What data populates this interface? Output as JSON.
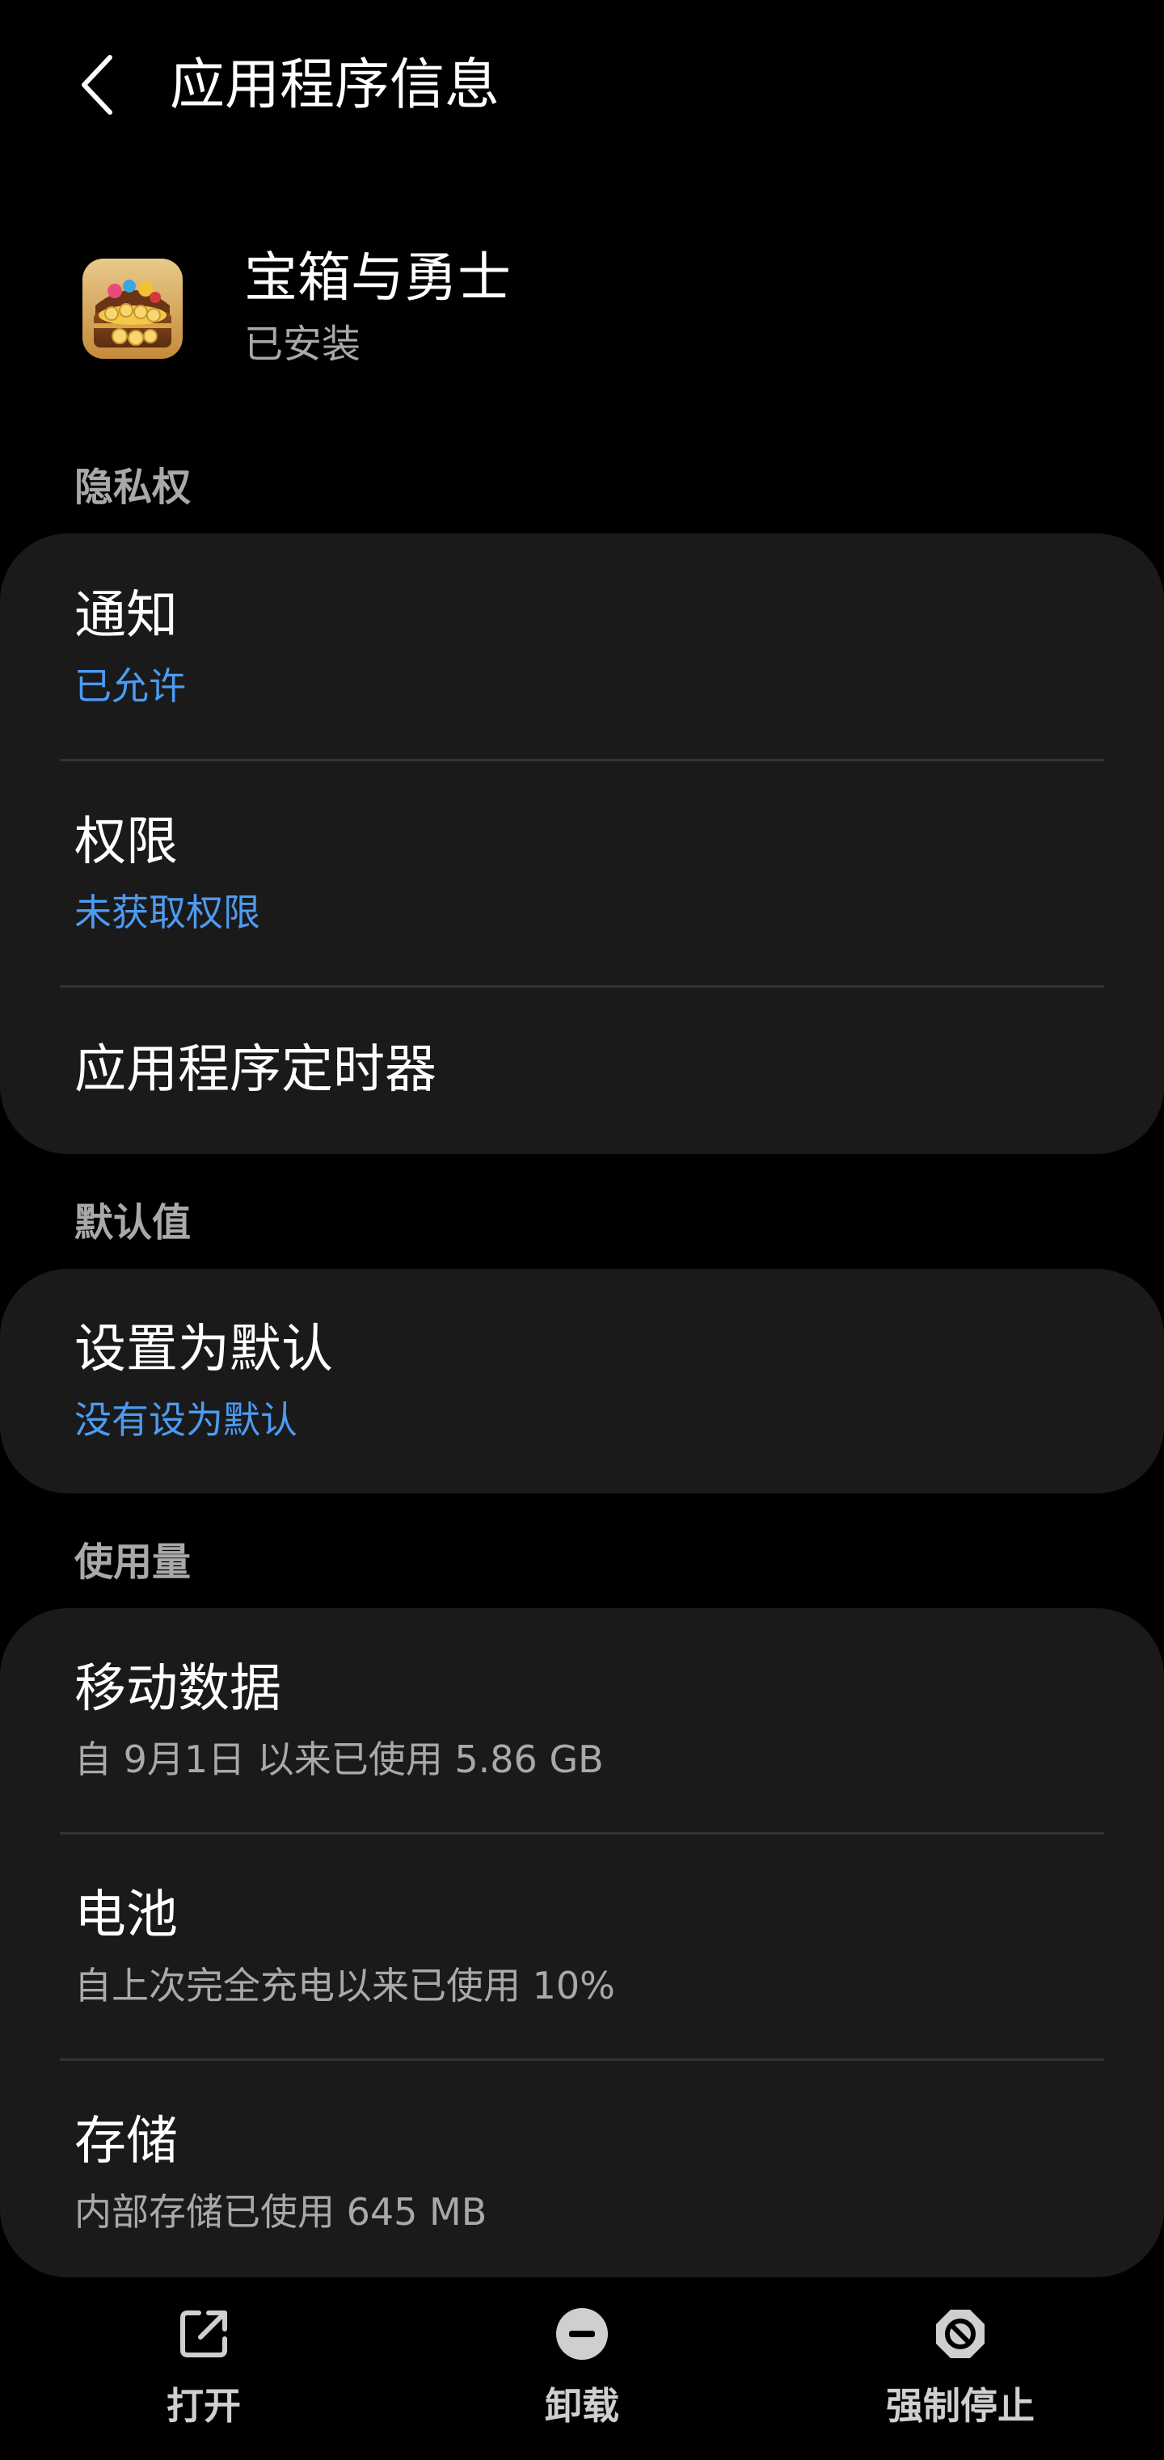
{
  "header": {
    "title": "应用程序信息",
    "back_icon": "chevron-left-icon"
  },
  "app": {
    "name": "宝箱与勇士",
    "status": "已安装",
    "icon": "treasure-chest-app-icon"
  },
  "sections": {
    "privacy": {
      "label": "隐私权",
      "items": [
        {
          "title": "通知",
          "subtitle": "已允许"
        },
        {
          "title": "权限",
          "subtitle": "未获取权限"
        },
        {
          "title": "应用程序定时器"
        }
      ]
    },
    "defaults": {
      "label": "默认值",
      "items": [
        {
          "title": "设置为默认",
          "subtitle": "没有设为默认"
        }
      ]
    },
    "usage": {
      "label": "使用量",
      "items": [
        {
          "title": "移动数据",
          "subtitle": "自 9月1日 以来已使用 5.86 GB"
        },
        {
          "title": "电池",
          "subtitle": "自上次完全充电以来已使用 10%"
        },
        {
          "title": "存储",
          "subtitle": "内部存储已使用 645 MB"
        }
      ]
    }
  },
  "actions": {
    "open": {
      "label": "打开",
      "icon": "open-external-icon"
    },
    "uninstall": {
      "label": "卸载",
      "icon": "minus-circle-icon"
    },
    "force_stop": {
      "label": "强制停止",
      "icon": "block-circle-icon"
    }
  },
  "colors": {
    "background": "#000000",
    "card": "#1a1a1a",
    "accent_blue": "#4c9bf2",
    "secondary_text": "#a9a9a9"
  }
}
